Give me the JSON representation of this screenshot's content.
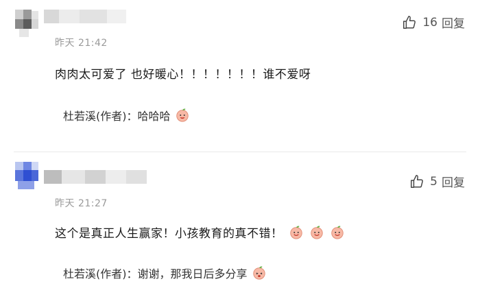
{
  "comments": [
    {
      "time_label": "昨天 21:42",
      "like_count": "16",
      "reply_label": "回复",
      "text": "肉肉太可爱了 也好暖心！！！！！！！谁不爱呀",
      "author_reply": {
        "author": "杜若溪(作者)",
        "separator": "：",
        "text": "哈哈哈",
        "emojis": [
          "peach-smile-emoji"
        ]
      }
    },
    {
      "time_label": "昨天 21:27",
      "like_count": "5",
      "reply_label": "回复",
      "text": "这个是真正人生赢家！小孩教育的真不错！",
      "emojis": [
        "peach-smile-emoji",
        "peach-smile-emoji",
        "peach-smile-emoji"
      ],
      "author_reply": {
        "author": "杜若溪(作者)",
        "separator": "：",
        "text": "谢谢，那我日后多分享",
        "emojis": [
          "peach-shy-emoji"
        ]
      }
    }
  ],
  "colors": {
    "blur_blue": "#3a5bd9",
    "blur_gray": "#d0d0d0",
    "meta_gray": "#9a9a9a"
  }
}
